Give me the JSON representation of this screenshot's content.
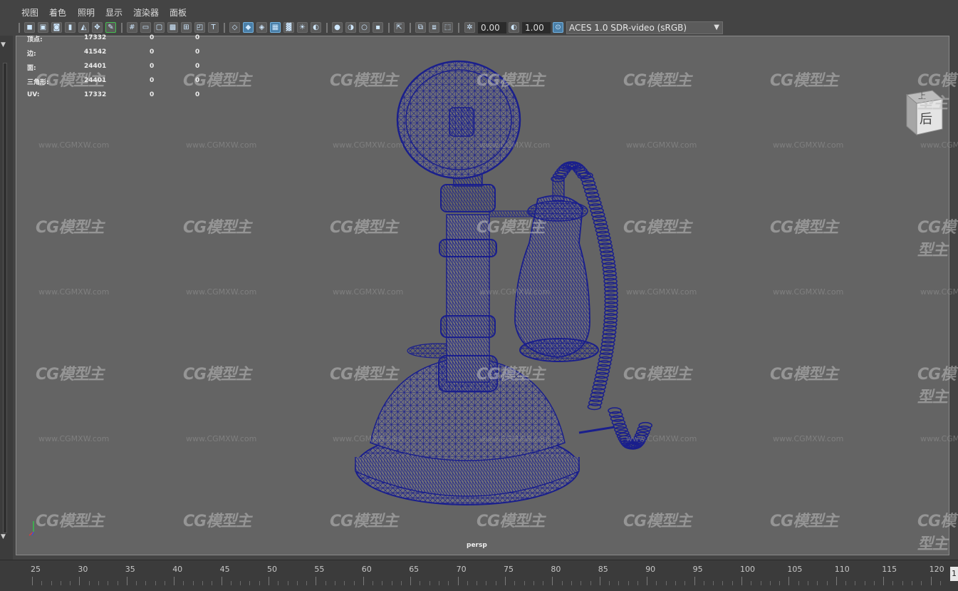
{
  "menu": [
    "视图",
    "着色",
    "照明",
    "显示",
    "渲染器",
    "面板"
  ],
  "toolbar": {
    "icons_group1": [
      "camera-icon",
      "camera-attributes-icon",
      "camera-lock-icon",
      "bookmark-icon",
      "image-plane-icon",
      "pan-zoom-icon",
      "grease-pencil-icon"
    ],
    "icons_group2": [
      "grid-icon",
      "film-gate-icon",
      "resolution-gate-icon",
      "gate-mask-icon",
      "field-chart-icon",
      "safe-action-icon",
      "safe-title-icon"
    ],
    "icons_group3": [
      "wireframe-icon",
      "smooth-shade-icon",
      "wireframe-on-shaded-icon",
      "textured-icon",
      "use-all-lights-icon",
      "shadows-icon",
      "screen-space-ao-icon"
    ],
    "icons_group4": [
      "xray-icon",
      "xray-joints-icon",
      "xray-components-icon",
      "isolate-select-icon"
    ],
    "icons_group5": [
      "select-camera-icon",
      "hud-icon",
      "two-sided-lighting-icon",
      "frame-all-icon"
    ],
    "exposure_value": "0.00",
    "gamma_value": "1.00",
    "color_space": "ACES 1.0 SDR-video (sRGB)"
  },
  "hud": {
    "rows": [
      {
        "label": "顶点:",
        "values": [
          "17332",
          "0",
          "0"
        ]
      },
      {
        "label": "边:",
        "values": [
          "41542",
          "0",
          "0"
        ]
      },
      {
        "label": "面:",
        "values": [
          "24401",
          "0",
          "0"
        ]
      },
      {
        "label": "三角形:",
        "values": [
          "24401",
          "0",
          "0"
        ]
      },
      {
        "label": "UV:",
        "values": [
          "17332",
          "0",
          "0"
        ]
      }
    ]
  },
  "viewport": {
    "camera": "persp",
    "viewcube_top": "上",
    "viewcube_face": "后",
    "wire_color": "#1a1f8c"
  },
  "watermark": {
    "logo": "CG模型主",
    "url": "www.CGMXW.com"
  },
  "timeline": {
    "ticks": [
      "25",
      "30",
      "35",
      "40",
      "45",
      "50",
      "55",
      "60",
      "65",
      "70",
      "75",
      "80",
      "85",
      "90",
      "95",
      "100",
      "105",
      "110",
      "115",
      "120"
    ],
    "end_frame": "1"
  }
}
